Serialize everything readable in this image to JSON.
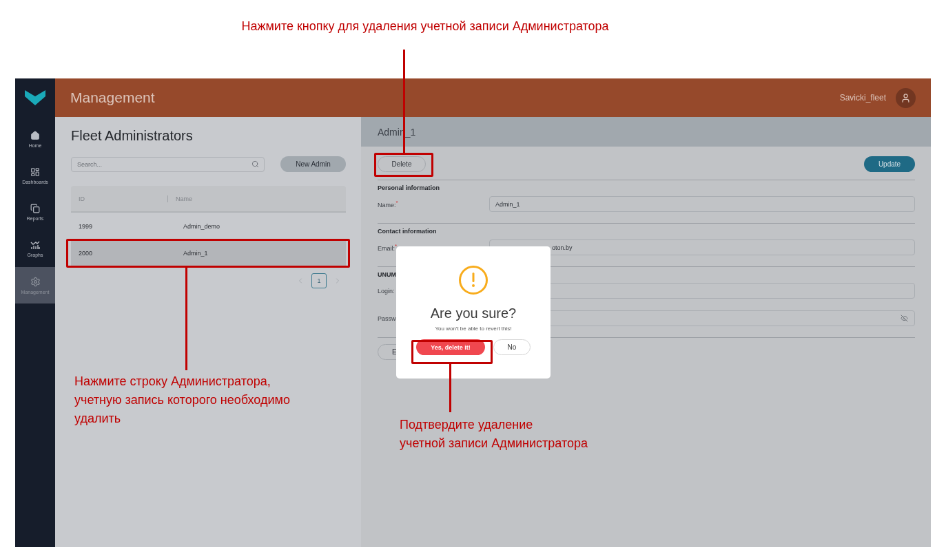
{
  "annotations": [
    {
      "kind": "top",
      "text": "Нажмите кнопку для удаления учетной записи Администратора"
    },
    {
      "kind": "row",
      "text": "Нажмите строку Администратора,\nучетную запись которого необходимо\nудалить"
    },
    {
      "kind": "confirm",
      "text": "Подтвердите удаление\nучетной записи Администратора"
    }
  ],
  "header": {
    "title": "Management",
    "user": "Savicki_fleet"
  },
  "sidebar": {
    "items": [
      {
        "label": "Home",
        "selected": false
      },
      {
        "label": "Dashboards",
        "selected": false
      },
      {
        "label": "Reports",
        "selected": false
      },
      {
        "label": "Graphs",
        "selected": false
      },
      {
        "label": "Management",
        "selected": true
      }
    ]
  },
  "list_panel": {
    "title": "Fleet Administrators",
    "search": {
      "placeholder": "Search..."
    },
    "new_button": "New Admin",
    "table": {
      "columns": [
        "ID",
        "Name"
      ],
      "rows": [
        {
          "id": "1999",
          "name": "Admin_demo",
          "selected": false
        },
        {
          "id": "2000",
          "name": "Admin_1",
          "selected": true
        }
      ]
    },
    "pagination": {
      "pages": [
        {
          "label": "1",
          "selected": true
        }
      ]
    }
  },
  "detail_panel": {
    "title": "Admin_1",
    "delete_button": "Delete",
    "update_button": "Update",
    "sections": [
      {
        "title": "Personal information",
        "fields": [
          {
            "kind": "text",
            "label": "Name:",
            "mark": "*",
            "value": "Admin_1"
          }
        ]
      },
      {
        "title": "Contact information",
        "fields": [
          {
            "kind": "email",
            "label": "Email:",
            "mark": "*",
            "value": "oton.by"
          }
        ]
      },
      {
        "title": "UNUM",
        "fields": [
          {
            "kind": "text",
            "label": "Login:"
          },
          {
            "kind": "password",
            "label": "Passw"
          }
        ]
      }
    ],
    "bottom_button": "E"
  },
  "dialog": {
    "title": "Are you sure?",
    "message": "You won't be able to revert this!",
    "confirm": "Yes, delete it!",
    "cancel": "No"
  }
}
